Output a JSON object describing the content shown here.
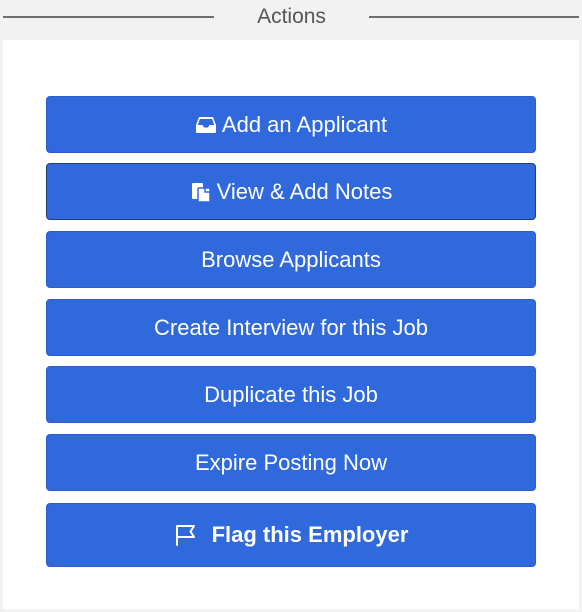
{
  "header": {
    "title": "Actions"
  },
  "actions": [
    {
      "label": "Add an Applicant",
      "icon": "inbox-icon"
    },
    {
      "label": "View & Add Notes",
      "icon": "notes-icon"
    },
    {
      "label": "Browse Applicants"
    },
    {
      "label": "Create Interview for this Job"
    },
    {
      "label": "Duplicate this Job"
    },
    {
      "label": "Expire Posting Now"
    },
    {
      "label": "Flag this Employer",
      "icon": "flag-icon"
    }
  ],
  "colors": {
    "button_bg": "#3069dc",
    "button_text": "#ffffff",
    "header_bg": "#f2f2f2",
    "header_text": "#555555"
  }
}
